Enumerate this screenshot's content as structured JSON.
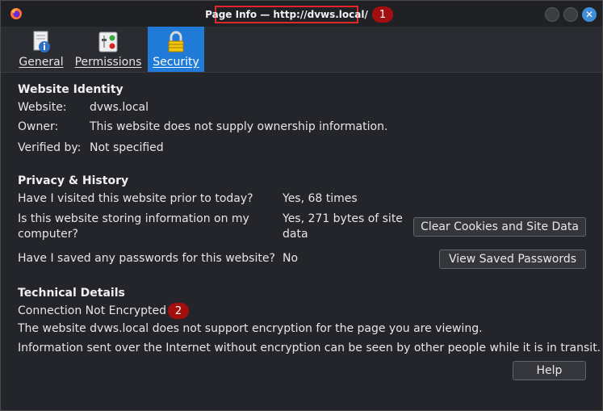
{
  "window": {
    "title": "Page Info — http://dvws.local/",
    "annotations": [
      "1",
      "2"
    ],
    "close_glyph": "✕"
  },
  "tabs": [
    {
      "label": "General"
    },
    {
      "label": "Permissions"
    },
    {
      "label": "Security",
      "active": true
    }
  ],
  "identity": {
    "heading": "Website Identity",
    "website_label": "Website:",
    "website_value": "dvws.local",
    "owner_label": "Owner:",
    "owner_value": "This website does not supply ownership information.",
    "verified_label": "Verified by:",
    "verified_value": "Not specified"
  },
  "privacy": {
    "heading": "Privacy & History",
    "visited_q": "Have I visited this website prior to today?",
    "visited_a": "Yes, 68 times",
    "storing_q_line1": "Is this website storing information on my",
    "storing_q_line2": "computer?",
    "storing_a_line1": "Yes, 271 bytes of site",
    "storing_a_line2": "data",
    "clear_button": "Clear Cookies and Site Data",
    "passwords_q": "Have I saved any passwords for this website?",
    "passwords_a": "No",
    "view_passwords_button": "View Saved Passwords"
  },
  "technical": {
    "heading": "Technical Details",
    "connection": "Connection Not Encrypted",
    "line1": "The website dvws.local does not support encryption for the page you are viewing.",
    "line2": "Information sent over the Internet without encryption can be seen by other people while it is in transit."
  },
  "footer": {
    "help_button": "Help"
  },
  "colors": {
    "accent": "#1f7ad8",
    "annotation_badge": "#a30f0f",
    "annotation_box": "#e0282c"
  }
}
